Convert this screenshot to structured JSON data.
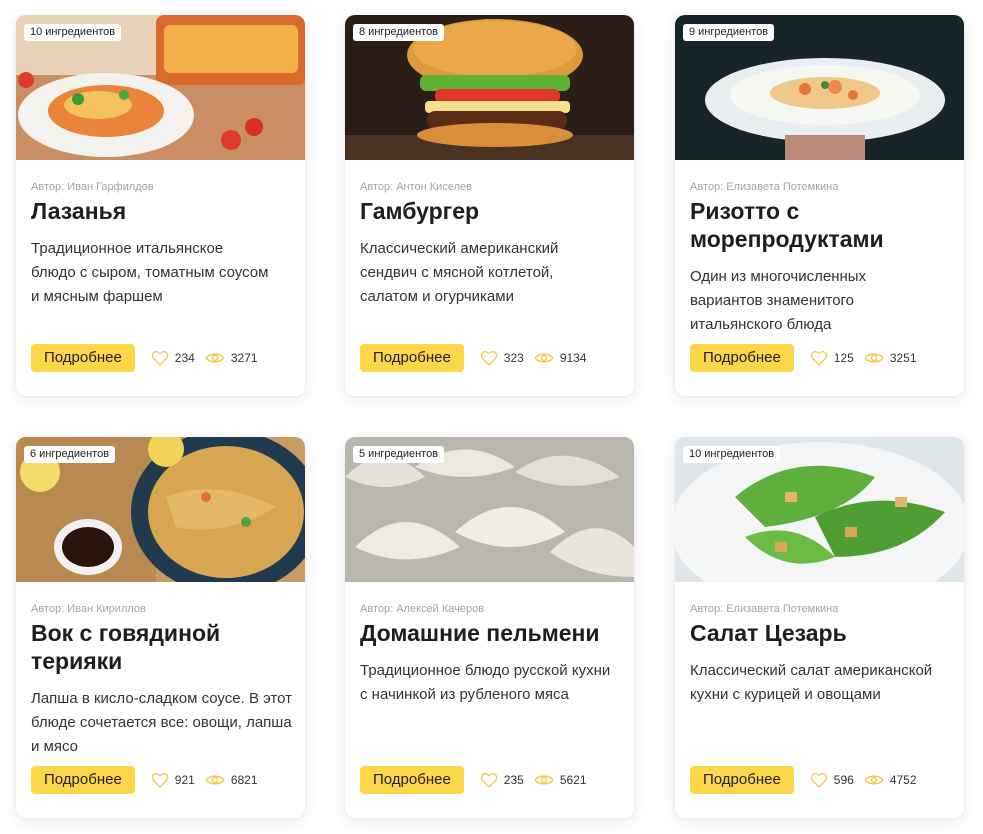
{
  "cards": [
    {
      "badge": "10 ингредиентов",
      "author": "Автор: Иван Гарфилдов",
      "title": "Лазанья",
      "desc": "Традиционное итальянское блюдо с сыром, томатным соусом и мясным фаршем",
      "button": "Подробнее",
      "likes": "234",
      "views": "3271"
    },
    {
      "badge": "8 ингредиентов",
      "author": "Автор: Антон Киселев",
      "title": "Гамбургер",
      "desc": "Классический американский сендвич с мясной котлетой, салатом и огурчиками",
      "button": "Подробнее",
      "likes": "323",
      "views": "9134"
    },
    {
      "badge": "9 ингредиентов",
      "author": "Автор: Елизавета Потемкина",
      "title": "Ризотто с морепродуктами",
      "desc": "Один из многочисленных вариантов знаменитого итальянского блюда",
      "button": "Подробнее",
      "likes": "125",
      "views": "3251"
    },
    {
      "badge": "6 ингредиентов",
      "author": "Автор: Иван Кириллов",
      "title": "Вок с говядиной терияки",
      "desc": "Лапша в кисло-сладком соусе. В этот блюде сочетается все: овощи, лапша и мясо",
      "button": "Подробнее",
      "likes": "921",
      "views": "6821"
    },
    {
      "badge": "5 ингредиентов",
      "author": "Автор: Алексей Качеров",
      "title": "Домашние пельмени",
      "desc": "Традиционное блюдо русской кухни с начинкой из рубленого мяса",
      "button": "Подробнее",
      "likes": "235",
      "views": "5621"
    },
    {
      "badge": "10 ингредиентов",
      "author": "Автор: Елизавета Потемкина",
      "title": "Салат Цезарь",
      "desc": "Классический салат американской кухни с курицей и овощами",
      "button": "Подробнее",
      "likes": "596",
      "views": "4752"
    }
  ],
  "colors": {
    "accent": "#fdd64a",
    "icon": "#f2c94c",
    "muted": "#a3a3a3"
  },
  "icons": {
    "likes": "heart-icon",
    "views": "eye-icon"
  }
}
